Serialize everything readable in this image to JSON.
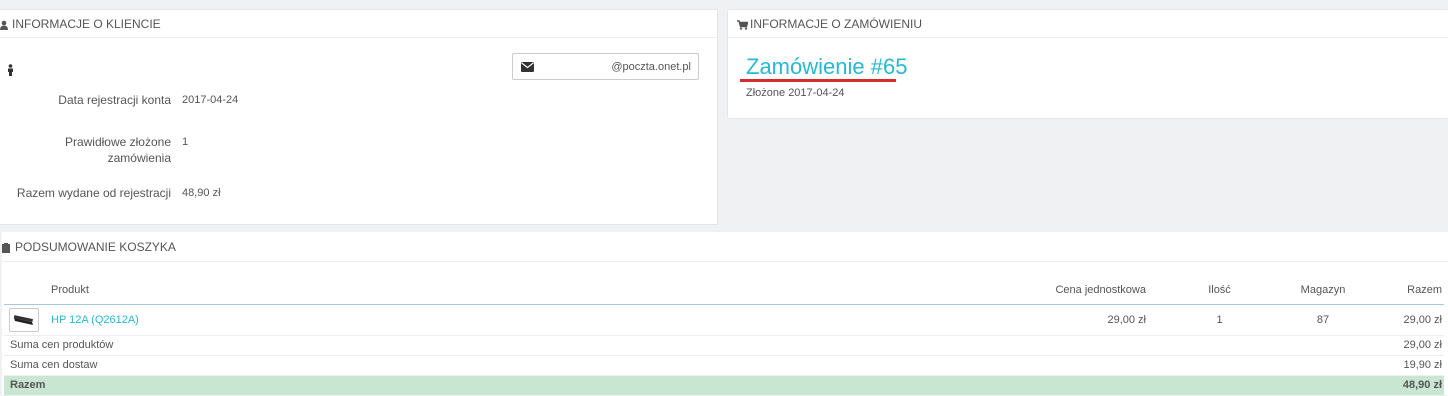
{
  "customer_panel": {
    "heading": "INFORMACJE O KLIENCIE",
    "email": "@poczta.onet.pl",
    "registration_label": "Data rejestracji konta",
    "registration_value": "2017-04-24",
    "orders_label_line1": "Prawidłowe złożone",
    "orders_label_line2": "zamówienia",
    "orders_value": "1",
    "spent_label": "Razem wydane od rejestracji",
    "spent_value": "48,90 zł"
  },
  "order_panel": {
    "heading": "INFORMACJE O ZAMÓWIENIU",
    "title": "Zamówienie #65",
    "date": "Złożone 2017-04-24"
  },
  "cart_panel": {
    "heading": "PODSUMOWANIE KOSZYKA",
    "columns": {
      "product": "Produkt",
      "unit_price": "Cena jednostkowa",
      "quantity": "Ilość",
      "stock": "Magazyn",
      "total": "Razem"
    },
    "product": {
      "name": "HP 12A (Q2612A)",
      "unit_price": "29,00 zł",
      "quantity": "1",
      "stock": "87",
      "total": "29,00 zł"
    },
    "summary": {
      "products_label": "Suma cen produktów",
      "products_value": "29,00 zł",
      "shipping_label": "Suma cen dostaw",
      "shipping_value": "19,90 zł",
      "total_label": "Razem",
      "total_value": "48,90 zł"
    }
  },
  "colors": {
    "accent": "#25b9d7",
    "underline": "#d62c2c",
    "total_row": "#c9e6d2"
  }
}
